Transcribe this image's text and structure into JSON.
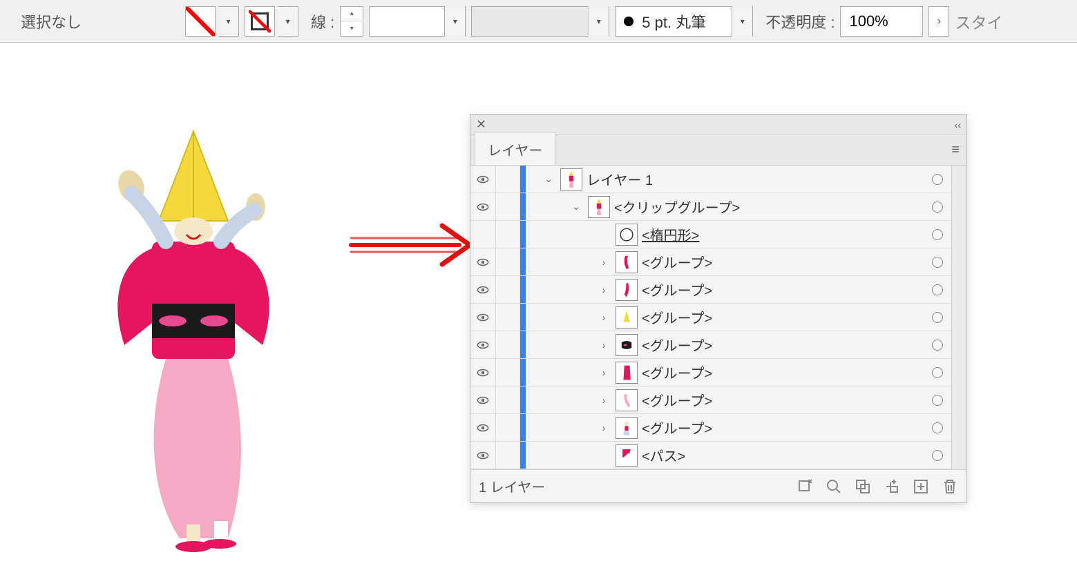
{
  "toolbar": {
    "selection_label": "選択なし",
    "stroke_label": "線 :",
    "brush_label": "5 pt. 丸筆",
    "opacity_label": "不透明度 :",
    "opacity_value": "100%",
    "overflow_text": "スタイ"
  },
  "panel": {
    "tab_label": "レイヤー",
    "footer_label": "1 レイヤー"
  },
  "layers": [
    {
      "indent": 0,
      "label": "レイヤー 1",
      "expander": "down",
      "visible": true,
      "thumb": "dancer",
      "underline": false
    },
    {
      "indent": 1,
      "label": "<クリップグループ>",
      "expander": "down",
      "visible": true,
      "thumb": "dancer",
      "underline": false
    },
    {
      "indent": 2,
      "label": "<楕円形>",
      "expander": "none",
      "visible": false,
      "thumb": "circle",
      "underline": true
    },
    {
      "indent": 2,
      "label": "<グループ>",
      "expander": "right",
      "visible": true,
      "thumb": "pink1",
      "underline": false
    },
    {
      "indent": 2,
      "label": "<グループ>",
      "expander": "right",
      "visible": true,
      "thumb": "pink2",
      "underline": false
    },
    {
      "indent": 2,
      "label": "<グループ>",
      "expander": "right",
      "visible": true,
      "thumb": "hat",
      "underline": false
    },
    {
      "indent": 2,
      "label": "<グループ>",
      "expander": "right",
      "visible": true,
      "thumb": "obi",
      "underline": false
    },
    {
      "indent": 2,
      "label": "<グループ>",
      "expander": "right",
      "visible": true,
      "thumb": "kimono",
      "underline": false
    },
    {
      "indent": 2,
      "label": "<グループ>",
      "expander": "right",
      "visible": true,
      "thumb": "leg",
      "underline": false
    },
    {
      "indent": 2,
      "label": "<グループ>",
      "expander": "right",
      "visible": true,
      "thumb": "body",
      "underline": false
    },
    {
      "indent": 2,
      "label": "<パス>",
      "expander": "none",
      "visible": true,
      "thumb": "shape",
      "underline": false
    }
  ],
  "icons": {
    "eye": "visibility-icon"
  }
}
